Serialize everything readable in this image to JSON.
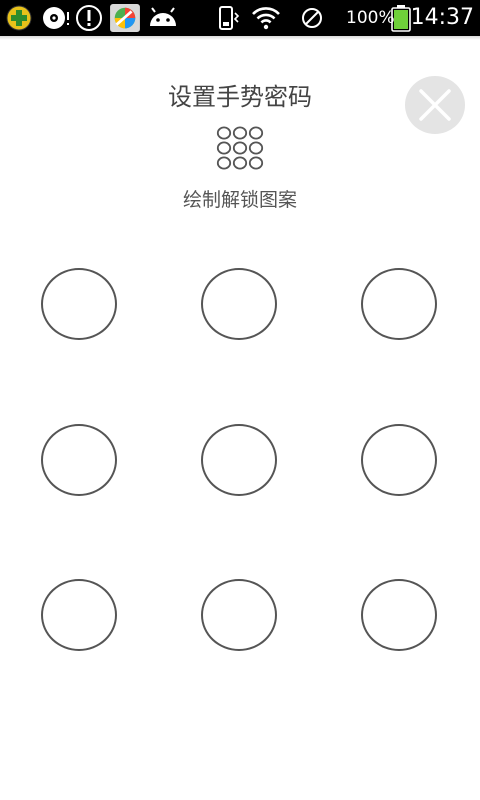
{
  "status_bar": {
    "battery_percent": "100%",
    "time": "14:37",
    "icons": [
      "app-plus-icon",
      "disc-icon",
      "alert-icon",
      "app-store-icon",
      "android-icon",
      "vibrate-icon",
      "wifi-icon",
      "no-disturb-icon",
      "battery-icon"
    ],
    "colors": {
      "background": "#000000",
      "battery": "#6fd13a"
    }
  },
  "header": {
    "title": "设置手势密码",
    "subtitle": "绘制解锁图案",
    "close_icon": "close-icon"
  },
  "pattern": {
    "rows": 3,
    "cols": 3,
    "dots": [
      "1",
      "2",
      "3",
      "4",
      "5",
      "6",
      "7",
      "8",
      "9"
    ]
  },
  "colors": {
    "dot_border": "#555555",
    "close_bg": "#e4e4e4"
  }
}
